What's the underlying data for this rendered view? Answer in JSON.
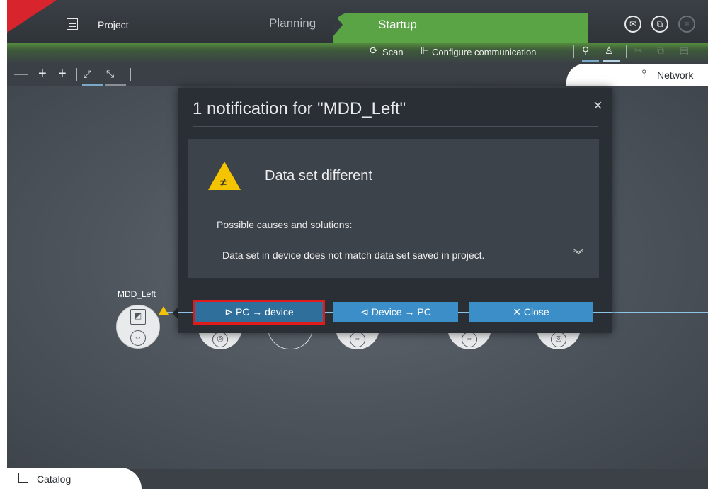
{
  "top_bar": {
    "project_label": "Project",
    "planning_label": "Planning",
    "startup_label": "Startup",
    "icons": [
      "mail-icon",
      "binoculars-icon",
      "document-icon"
    ]
  },
  "toolbar2": {
    "scan_label": "Scan",
    "configure_label": "Configure communication"
  },
  "row3": {
    "zoom_out": "—",
    "zoom_in": "+",
    "add_node": "+",
    "network_label": "Network"
  },
  "canvas": {
    "device_label": "MDD_Left"
  },
  "modal": {
    "title": "1 notification for \"MDD_Left\"",
    "close_glyph": "×",
    "notification_title": "Data set different",
    "causes_label": "Possible causes and solutions:",
    "cause_text": "Data set in device does not match data set saved in project.",
    "buttons": {
      "pc_to_device": "PC → device",
      "device_to_pc": "Device → PC",
      "close": "Close"
    }
  },
  "catalog": {
    "label": "Catalog"
  },
  "colors": {
    "accent_green": "#5aa446",
    "button_blue": "#3b8ec8",
    "warning_yellow": "#f5c400",
    "highlight_red": "#e01b1b",
    "flag_red": "#d8242d"
  }
}
